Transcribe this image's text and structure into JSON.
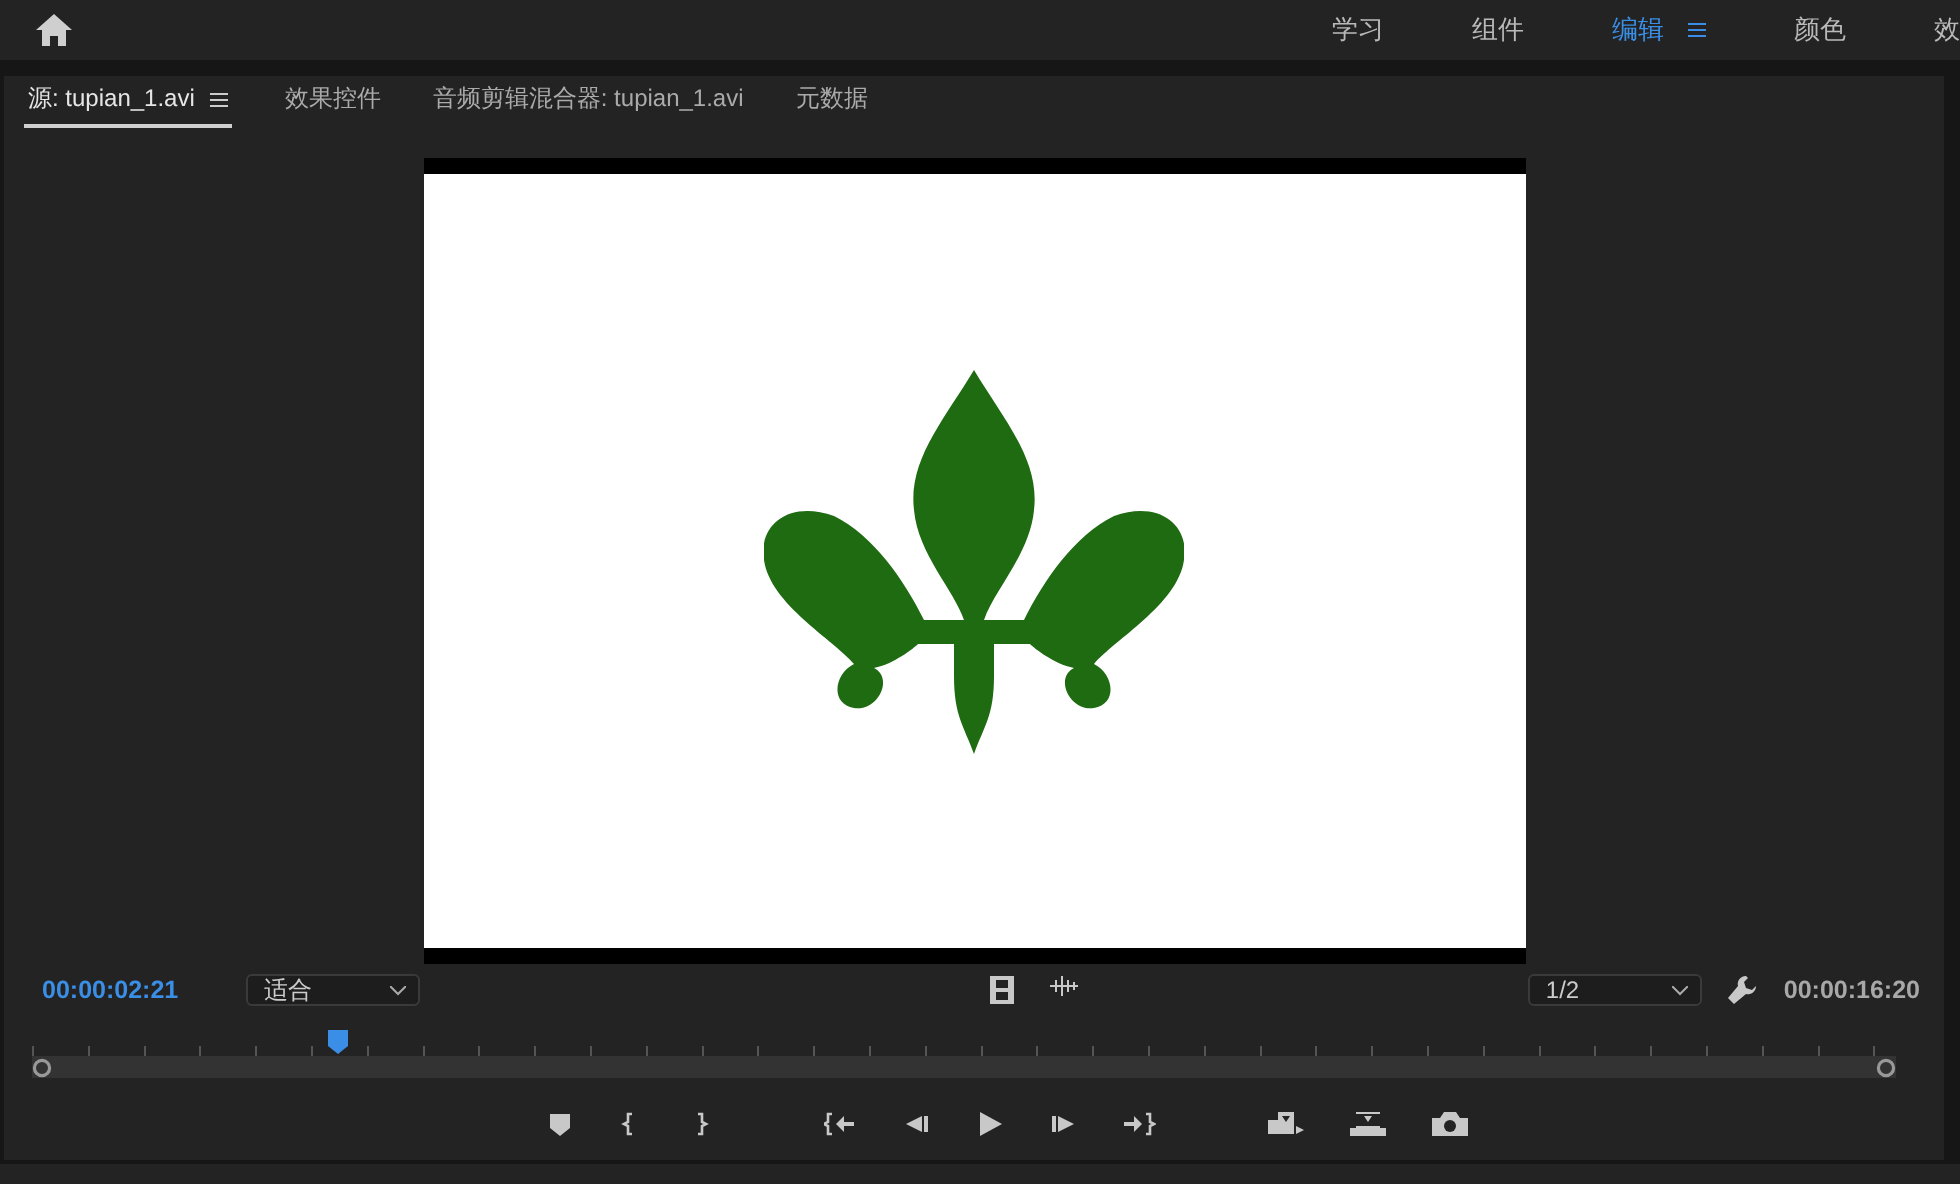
{
  "workspace_bar": {
    "tabs": [
      {
        "label": "学习",
        "selected": false
      },
      {
        "label": "组件",
        "selected": false
      },
      {
        "label": "编辑",
        "selected": true
      },
      {
        "label": "颜色",
        "selected": false
      },
      {
        "label": "效",
        "selected": false
      }
    ]
  },
  "source_monitor": {
    "tabs": [
      {
        "label": "源: tupian_1.avi",
        "selected": true
      },
      {
        "label": "效果控件",
        "selected": false
      },
      {
        "label": "音频剪辑混合器: tupian_1.avi",
        "selected": false
      },
      {
        "label": "元数据",
        "selected": false
      }
    ],
    "current_time": "00:00:02:21",
    "zoom": {
      "value": "适合"
    },
    "resolution": {
      "value": "1/2"
    },
    "duration": "00:00:16:20",
    "playhead": {
      "level": 0.163
    }
  }
}
